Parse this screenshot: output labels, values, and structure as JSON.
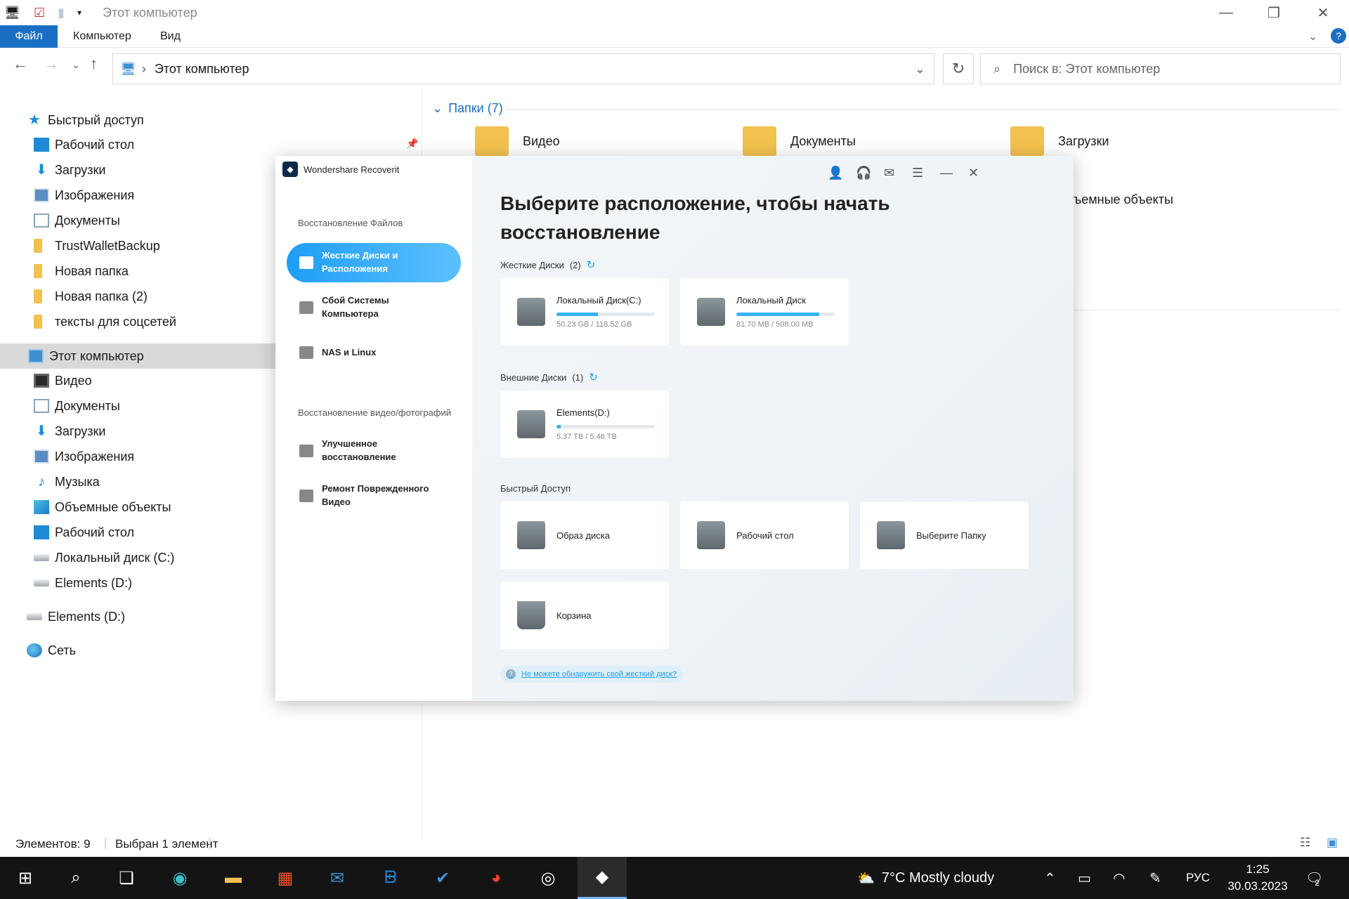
{
  "explorer": {
    "title": "Этот компьютер",
    "ribbon": {
      "file": "Файл",
      "computer": "Компьютер",
      "view": "Вид"
    },
    "address": {
      "path": "Этот компьютер",
      "search_placeholder": "Поиск в: Этот компьютер"
    },
    "nav": {
      "quick_access": "Быстрый доступ",
      "quick_items": [
        "Рабочий стол",
        "Загрузки",
        "Изображения",
        "Документы",
        "TrustWalletBackup",
        "Новая папка",
        "Новая папка (2)",
        "тексты для соцсетей"
      ],
      "this_pc": "Этот компьютер",
      "pc_items": [
        "Видео",
        "Документы",
        "Загрузки",
        "Изображения",
        "Музыка",
        "Объемные объекты",
        "Рабочий стол",
        "Локальный диск (C:)",
        "Elements (D:)"
      ],
      "elements": "Elements (D:)",
      "network": "Сеть"
    },
    "content": {
      "folders_header": "Папки (7)",
      "folders": [
        "Видео",
        "Документы",
        "Загрузки"
      ],
      "partial_label": "ъемные объекты"
    },
    "status": {
      "items": "Элементов: 9",
      "selected": "Выбран 1 элемент"
    }
  },
  "recoverit": {
    "app_name": "Wondershare Recoverit",
    "side": {
      "section_files": "Восстановление Файлов",
      "item_hdd": [
        "Жесткие Диски и",
        "Расположения"
      ],
      "item_crash": [
        "Сбой Системы",
        "Компьютера"
      ],
      "item_nas": "NAS и Linux",
      "section_media": "Восстановление видео/фотографий",
      "item_enhanced": [
        "Улучшенное",
        "восстановление"
      ],
      "item_repair": [
        "Ремонт Поврежденного",
        "Видео"
      ]
    },
    "heading": [
      "Выберите расположение, чтобы начать",
      "восстановление"
    ],
    "hard_disks": {
      "label": "Жесткие Диски",
      "count": "(2)"
    },
    "drives": [
      {
        "name": "Локальный Диск(C:)",
        "usage": "50.23 GB / 118.52 GB",
        "fill": 0.42
      },
      {
        "name": "Локальный Диск",
        "usage": "81.70 MB / 508.00 MB",
        "fill": 0.84
      }
    ],
    "external": {
      "label": "Внешние Диски",
      "count": "(1)"
    },
    "ext_drives": [
      {
        "name": "Elements(D:)",
        "usage": "5.37 TB / 5.46 TB",
        "fill": 0.04
      }
    ],
    "quick": {
      "label": "Быстрый Доступ",
      "items": [
        "Образ диска",
        "Рабочий стол",
        "Выберите Папку",
        "Корзина"
      ]
    },
    "help_link": "Не можете обнаружить свой жесткий диск?"
  },
  "taskbar": {
    "weather": "7°C  Mostly cloudy",
    "lang": "РУС",
    "time": "1:25",
    "date": "30.03.2023",
    "notif_count": "2"
  }
}
